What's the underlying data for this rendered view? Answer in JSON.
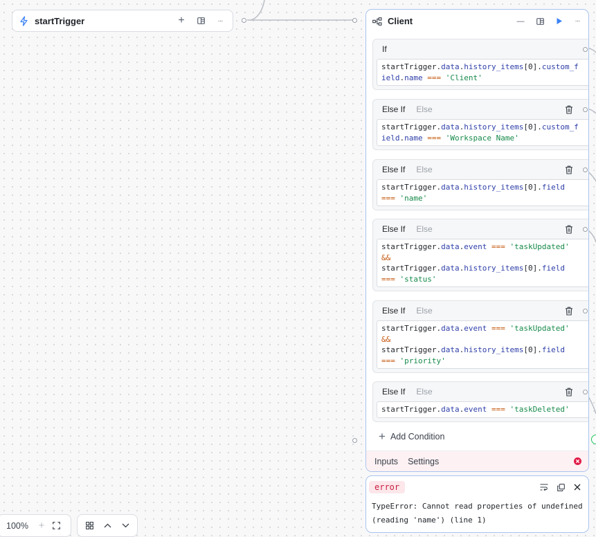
{
  "canvas": {
    "zoom": "100%"
  },
  "start_node": {
    "title": "startTrigger",
    "add_label": "+",
    "more_label": "···"
  },
  "client_node": {
    "title": "Client",
    "minimize_label": "—",
    "more_label": "···",
    "conditions": [
      {
        "type": "If",
        "else_label": "",
        "removable": false,
        "code": [
          [
            {
              "t": "startTrigger",
              "c": "id"
            },
            {
              "t": ".",
              "c": "pl"
            },
            {
              "t": "data",
              "c": "prop"
            },
            {
              "t": ".",
              "c": "pl"
            },
            {
              "t": "history_items",
              "c": "prop"
            },
            {
              "t": "[",
              "c": "pl"
            },
            {
              "t": "0",
              "c": "pl"
            },
            {
              "t": "].",
              "c": "pl"
            },
            {
              "t": "custom_f",
              "c": "prop"
            }
          ],
          [
            {
              "t": "ield",
              "c": "prop"
            },
            {
              "t": ".",
              "c": "pl"
            },
            {
              "t": "name",
              "c": "prop"
            },
            {
              "t": " ",
              "c": "pl"
            },
            {
              "t": "===",
              "c": "op"
            },
            {
              "t": " ",
              "c": "pl"
            },
            {
              "t": "'Client'",
              "c": "str"
            }
          ]
        ]
      },
      {
        "type": "Else If",
        "else_label": "Else",
        "removable": true,
        "code": [
          [
            {
              "t": "startTrigger",
              "c": "id"
            },
            {
              "t": ".",
              "c": "pl"
            },
            {
              "t": "data",
              "c": "prop"
            },
            {
              "t": ".",
              "c": "pl"
            },
            {
              "t": "history_items",
              "c": "prop"
            },
            {
              "t": "[",
              "c": "pl"
            },
            {
              "t": "0",
              "c": "pl"
            },
            {
              "t": "].",
              "c": "pl"
            },
            {
              "t": "custom_f",
              "c": "prop"
            }
          ],
          [
            {
              "t": "ield",
              "c": "prop"
            },
            {
              "t": ".",
              "c": "pl"
            },
            {
              "t": "name",
              "c": "prop"
            },
            {
              "t": " ",
              "c": "pl"
            },
            {
              "t": "===",
              "c": "op"
            },
            {
              "t": " ",
              "c": "pl"
            },
            {
              "t": "'Workspace Name'",
              "c": "str"
            }
          ]
        ]
      },
      {
        "type": "Else If",
        "else_label": "Else",
        "removable": true,
        "code": [
          [
            {
              "t": "startTrigger",
              "c": "id"
            },
            {
              "t": ".",
              "c": "pl"
            },
            {
              "t": "data",
              "c": "prop"
            },
            {
              "t": ".",
              "c": "pl"
            },
            {
              "t": "history_items",
              "c": "prop"
            },
            {
              "t": "[",
              "c": "pl"
            },
            {
              "t": "0",
              "c": "pl"
            },
            {
              "t": "].",
              "c": "pl"
            },
            {
              "t": "field",
              "c": "prop"
            }
          ],
          [
            {
              "t": "===",
              "c": "op"
            },
            {
              "t": " ",
              "c": "pl"
            },
            {
              "t": "'name'",
              "c": "str"
            }
          ]
        ]
      },
      {
        "type": "Else If",
        "else_label": "Else",
        "removable": true,
        "code": [
          [
            {
              "t": "startTrigger",
              "c": "id"
            },
            {
              "t": ".",
              "c": "pl"
            },
            {
              "t": "data",
              "c": "prop"
            },
            {
              "t": ".",
              "c": "pl"
            },
            {
              "t": "event",
              "c": "prop"
            },
            {
              "t": " ",
              "c": "pl"
            },
            {
              "t": "===",
              "c": "op"
            },
            {
              "t": " ",
              "c": "pl"
            },
            {
              "t": "'taskUpdated'",
              "c": "str"
            }
          ],
          [
            {
              "t": "&&",
              "c": "op"
            }
          ],
          [
            {
              "t": "startTrigger",
              "c": "id"
            },
            {
              "t": ".",
              "c": "pl"
            },
            {
              "t": "data",
              "c": "prop"
            },
            {
              "t": ".",
              "c": "pl"
            },
            {
              "t": "history_items",
              "c": "prop"
            },
            {
              "t": "[",
              "c": "pl"
            },
            {
              "t": "0",
              "c": "pl"
            },
            {
              "t": "].",
              "c": "pl"
            },
            {
              "t": "field",
              "c": "prop"
            }
          ],
          [
            {
              "t": "===",
              "c": "op"
            },
            {
              "t": " ",
              "c": "pl"
            },
            {
              "t": "'status'",
              "c": "str"
            }
          ]
        ]
      },
      {
        "type": "Else If",
        "else_label": "Else",
        "removable": true,
        "code": [
          [
            {
              "t": "startTrigger",
              "c": "id"
            },
            {
              "t": ".",
              "c": "pl"
            },
            {
              "t": "data",
              "c": "prop"
            },
            {
              "t": ".",
              "c": "pl"
            },
            {
              "t": "event",
              "c": "prop"
            },
            {
              "t": " ",
              "c": "pl"
            },
            {
              "t": "===",
              "c": "op"
            },
            {
              "t": " ",
              "c": "pl"
            },
            {
              "t": "'taskUpdated'",
              "c": "str"
            }
          ],
          [
            {
              "t": "&&",
              "c": "op"
            }
          ],
          [
            {
              "t": "startTrigger",
              "c": "id"
            },
            {
              "t": ".",
              "c": "pl"
            },
            {
              "t": "data",
              "c": "prop"
            },
            {
              "t": ".",
              "c": "pl"
            },
            {
              "t": "history_items",
              "c": "prop"
            },
            {
              "t": "[",
              "c": "pl"
            },
            {
              "t": "0",
              "c": "pl"
            },
            {
              "t": "].",
              "c": "pl"
            },
            {
              "t": "field",
              "c": "prop"
            }
          ],
          [
            {
              "t": "===",
              "c": "op"
            },
            {
              "t": " ",
              "c": "pl"
            },
            {
              "t": "'priority'",
              "c": "str"
            }
          ]
        ]
      },
      {
        "type": "Else If",
        "else_label": "Else",
        "removable": true,
        "code": [
          [
            {
              "t": "startTrigger",
              "c": "id"
            },
            {
              "t": ".",
              "c": "pl"
            },
            {
              "t": "data",
              "c": "prop"
            },
            {
              "t": ".",
              "c": "pl"
            },
            {
              "t": "event",
              "c": "prop"
            },
            {
              "t": " ",
              "c": "pl"
            },
            {
              "t": "===",
              "c": "op"
            },
            {
              "t": " ",
              "c": "pl"
            },
            {
              "t": "'taskDeleted'",
              "c": "str"
            }
          ]
        ]
      }
    ],
    "add_condition_label": "Add Condition",
    "tabs": [
      "Inputs",
      "Settings"
    ]
  },
  "error_panel": {
    "badge": "error",
    "message": "TypeError: Cannot read properties of undefined (reading 'name') (line 1)"
  },
  "colors": {
    "accent": "#3b82f6",
    "error": "#e11d48",
    "node_border_selected": "#a9c4f0"
  }
}
